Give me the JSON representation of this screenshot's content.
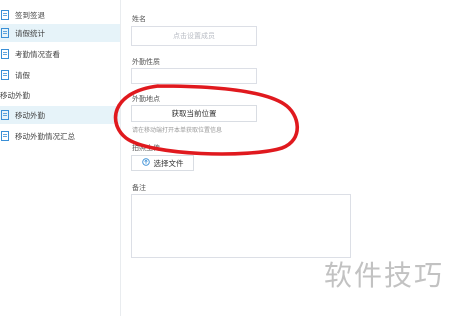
{
  "sidebar": {
    "items": [
      {
        "label": "签到签退",
        "icon": "document-icon"
      },
      {
        "label": "请假统计",
        "icon": "document-icon"
      },
      {
        "label": "考勤情况查看",
        "icon": "document-icon"
      },
      {
        "label": "请假",
        "icon": "document-icon"
      }
    ],
    "section_title": "移动外勤",
    "section_items": [
      {
        "label": "移动外勤",
        "icon": "document-icon"
      },
      {
        "label": "移动外勤情况汇总",
        "icon": "document-icon"
      }
    ]
  },
  "form": {
    "name_label": "姓名",
    "name_placeholder": "点击设置成员",
    "type_label": "外勤性质",
    "location_label": "外勤地点",
    "location_button": "获取当前位置",
    "location_hint": "请在移动端打开本单获取位置信息",
    "upload_label": "拍照上传",
    "upload_button": "选择文件",
    "remark_label": "备注"
  },
  "watermark": "软件技巧",
  "colors": {
    "active_bg": "#e6f3f9",
    "icon_blue": "#3a8fd6",
    "annotation_red": "#e0191e"
  }
}
